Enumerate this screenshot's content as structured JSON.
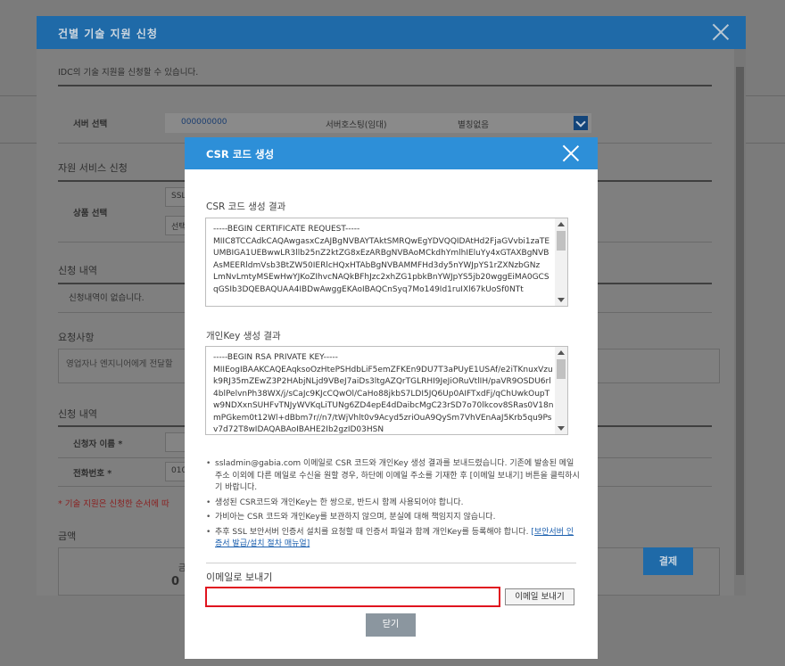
{
  "outer_modal": {
    "title": "건별 기술 지원 신청",
    "description": "IDC의 기술 지원을 신청할 수 있습니다.",
    "server_select": {
      "label": "서버 선택",
      "server_id": "000000000",
      "hosting": "서버호스팅(임대)",
      "nickname": "별칭없음"
    },
    "support_service_title": "자원 서비스 신청",
    "product_select_label": "상품 선택",
    "product_value_1": "SSL",
    "product_value_2": "선택",
    "request_history_title": "신청 내역",
    "request_history_empty": "신청내역이 없습니다.",
    "requirements_title": "요청사항",
    "requirements_placeholder": "영업자나 엔지니어에게 전달할",
    "applicant_section_title": "신청 내역",
    "applicant_name_label": "신청자 이름 *",
    "phone_label": "전화번호 *",
    "phone_value": "010",
    "notice": "* 기술 지원은 신청한 순서에 따",
    "amount_title": "금액",
    "amount_label_partial": "금",
    "amount_value": "0",
    "pay_button": "결제"
  },
  "csr_modal": {
    "title": "CSR 코드 생성",
    "csr_result_label": "CSR 코드 생성 결과",
    "csr_text": "-----BEGIN CERTIFICATE REQUEST-----\nMIIC8TCCAdkCAQAwgasxCzAJBgNVBAYTAktSMRQwEgYDVQQIDAtHd2FjaGVvbi1zaTEUMBIGA1UEBwwLR3llb25nZ2ktZG8xEzARBgNVBAoMCkdhYmlhIEluYy4xGTAXBgNVBAsMEERldmVsb3BtZW50IERlcHQxHTAbBgNVBAMMFHd3dy5nYWJpYS1rZXNzbGNz\nLmNvLmtyMSEwHwYJKoZIhvcNAQkBFhJzc2xhZG1pbkBnYWJpYS5jb20wggEiMA0GCSqGSIb3DQEBAQUAA4IBDwAwggEKAoIBAQCnSyq7Mo149Id1ruIXl67kUoSf0NTt",
    "key_result_label": "개인Key 생성 결과",
    "key_text": "-----BEGIN RSA PRIVATE KEY-----\nMIIEogIBAAKCAQEAqksoOzHtePSHdbLiF5emZFKEn9DU7T3aPUyE1USAf/e2iTKnuxVzuk9RJ35mZEwZ3P2HAbjNLjd9VBeJ7aiDs3ltgAZQrTGLRHI9JeJiORuVtlIH/paVR9OSDU6rl4blPelvnPh38WX/j/sCaJc9KJcCQwOl/CaHo88jkbS7LDI5JQ6Up0AIFTxdFj/qChUwkOupTw9NDXxnSUHFvTNJyWVKqLiTUNg6ZD4epE4dDaibcMgC23rSD7o70lkcov8SRas0V18nmPGkem0t12Wl+dBbm7r//n7/tWjVhlt0v9Acyd5zriOuA9QySm7VhVEnAaJ5Krb5qu9Psv7d72T8wIDAQABAoIBAHE2Ib2gzID03HSN",
    "notes": [
      "ssladmin@gabia.com 이메일로 CSR 코드와 개인Key 생성 결과를 보내드렸습니다. 기존에 발송된 메일 주소 이외에 다른 메일로 수신을 원할 경우, 하단에 이메일 주소를 기재한 후 [이메일 보내기] 버튼을 클릭하시기 바랍니다.",
      "생성된 CSR코드와 개인Key는 한 쌍으로, 반드시 함께 사용되어야 합니다.",
      "가비아는 CSR 코드와 개인Key를 보관하지 않으며, 분실에 대해 책임지지 않습니다.",
      "추후 SSL 보안서버 인증서 설치를 요청할 때 인증서 파일과 함께 개인Key를 등록해야 합니다."
    ],
    "manual_link": "[보안서버 인증서 발급/설치 절차 매뉴얼]",
    "email_label": "이메일로 보내기",
    "email_value": "",
    "send_button": "이메일 보내기",
    "close_button": "닫기"
  },
  "colors": {
    "outer_header": "#1f6aa8",
    "inner_header": "#2d8fd8",
    "email_border": "#e0141f",
    "close_button": "#8b969f"
  },
  "icons": [
    "close-icon",
    "chevron-down-icon",
    "scroll-up-icon",
    "scroll-down-icon"
  ]
}
